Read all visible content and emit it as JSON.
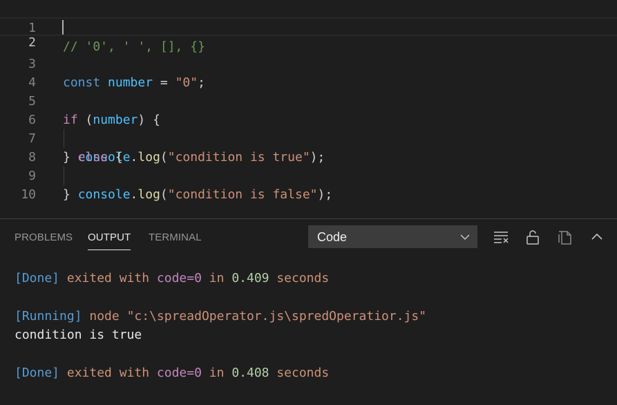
{
  "editor": {
    "lines": [
      {
        "num": "1",
        "tokens": [
          {
            "t": "// '0', ' ', [], {}",
            "c": "comment"
          }
        ]
      },
      {
        "num": "2",
        "tokens": []
      },
      {
        "num": "3",
        "tokens": [
          {
            "t": "const",
            "c": "kw"
          },
          {
            "t": " ",
            "c": "plain"
          },
          {
            "t": "number",
            "c": "var"
          },
          {
            "t": " = ",
            "c": "plain"
          },
          {
            "t": "\"0\"",
            "c": "str"
          },
          {
            "t": ";",
            "c": "plain"
          }
        ]
      },
      {
        "num": "4",
        "tokens": []
      },
      {
        "num": "5",
        "tokens": [
          {
            "t": "if",
            "c": "ctrl"
          },
          {
            "t": " (",
            "c": "plain"
          },
          {
            "t": "number",
            "c": "var"
          },
          {
            "t": ") {",
            "c": "plain"
          }
        ]
      },
      {
        "num": "6",
        "tokens": [
          {
            "t": "  ",
            "c": "plain"
          },
          {
            "t": "console",
            "c": "var"
          },
          {
            "t": ".",
            "c": "plain"
          },
          {
            "t": "log",
            "c": "fn"
          },
          {
            "t": "(",
            "c": "plain"
          },
          {
            "t": "\"condition is true\"",
            "c": "str"
          },
          {
            "t": ");",
            "c": "plain"
          }
        ]
      },
      {
        "num": "7",
        "tokens": [
          {
            "t": "} ",
            "c": "plain"
          },
          {
            "t": "else",
            "c": "ctrl"
          },
          {
            "t": " {",
            "c": "plain"
          }
        ]
      },
      {
        "num": "8",
        "tokens": [
          {
            "t": "  ",
            "c": "plain"
          },
          {
            "t": "console",
            "c": "var"
          },
          {
            "t": ".",
            "c": "plain"
          },
          {
            "t": "log",
            "c": "fn"
          },
          {
            "t": "(",
            "c": "plain"
          },
          {
            "t": "\"condition is false\"",
            "c": "str"
          },
          {
            "t": ");",
            "c": "plain"
          }
        ]
      },
      {
        "num": "9",
        "tokens": [
          {
            "t": "}",
            "c": "plain"
          }
        ]
      },
      {
        "num": "10",
        "tokens": []
      }
    ]
  },
  "panel": {
    "tabs": [
      {
        "label": "PROBLEMS",
        "active": false
      },
      {
        "label": "OUTPUT",
        "active": true
      },
      {
        "label": "TERMINAL",
        "active": false
      }
    ],
    "dropdown": {
      "selected": "Code",
      "icon": "chevron-down-icon"
    },
    "toolbar_icons": [
      "clear-output-icon",
      "lock-icon",
      "open-file-icon",
      "chevron-up-icon"
    ]
  },
  "output": {
    "lines": [
      {
        "tokens": [
          {
            "t": "[Done]",
            "c": "tag"
          },
          {
            "t": " exited with ",
            "c": "word"
          },
          {
            "t": "code=0",
            "c": "code"
          },
          {
            "t": " in ",
            "c": "word"
          },
          {
            "t": "0.409",
            "c": "num"
          },
          {
            "t": " seconds",
            "c": "word"
          }
        ]
      },
      {
        "tokens": []
      },
      {
        "tokens": [
          {
            "t": "[Running]",
            "c": "tag"
          },
          {
            "t": " node ",
            "c": "word"
          },
          {
            "t": "\"c:\\spreadOperator.js\\spredOperatior.js\"",
            "c": "path"
          }
        ]
      },
      {
        "tokens": [
          {
            "t": "condition is true",
            "c": "plain"
          }
        ]
      },
      {
        "tokens": []
      },
      {
        "tokens": [
          {
            "t": "[Done]",
            "c": "tag"
          },
          {
            "t": " exited with ",
            "c": "word"
          },
          {
            "t": "code=0",
            "c": "code"
          },
          {
            "t": " in ",
            "c": "word"
          },
          {
            "t": "0.408",
            "c": "num"
          },
          {
            "t": " seconds",
            "c": "word"
          }
        ]
      }
    ]
  }
}
